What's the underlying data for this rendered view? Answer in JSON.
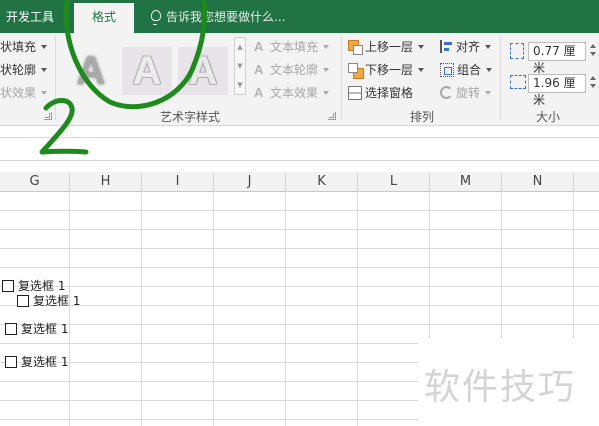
{
  "tabs": {
    "developer": "开发工具",
    "format": "格式",
    "tell_me": "告诉我您想要做什么..."
  },
  "ribbon": {
    "shape_styles": {
      "fill": "状填充",
      "outline": "状轮廓",
      "effects": "状效果"
    },
    "wordart": {
      "text_fill": "文本填充",
      "text_outline": "文本轮廓",
      "text_effects": "文本效果",
      "group_label": "艺术字样式",
      "sample_glyph": "A"
    },
    "arrange": {
      "bring_forward": "上移一层",
      "send_backward": "下移一层",
      "selection_pane": "选择窗格",
      "align": "对齐",
      "group": "组合",
      "rotate": "旋转",
      "group_label": "排列"
    },
    "size": {
      "height": "0.77 厘米",
      "width": "1.96 厘米",
      "group_label": "大小"
    }
  },
  "columns": [
    "G",
    "H",
    "I",
    "J",
    "K",
    "L",
    "M",
    "N"
  ],
  "checkboxes": [
    {
      "label": "复选框 1"
    },
    {
      "label": "复选框 1"
    },
    {
      "label": "复选框 1"
    },
    {
      "label": "复选框 1"
    }
  ],
  "annotation": {
    "number": "2",
    "ink_color": "#1e8a1e"
  },
  "watermark": "软件技巧",
  "colors": {
    "accent": "#217346",
    "ribbon_bg": "#f3f3f3",
    "gridline": "#dadada"
  }
}
